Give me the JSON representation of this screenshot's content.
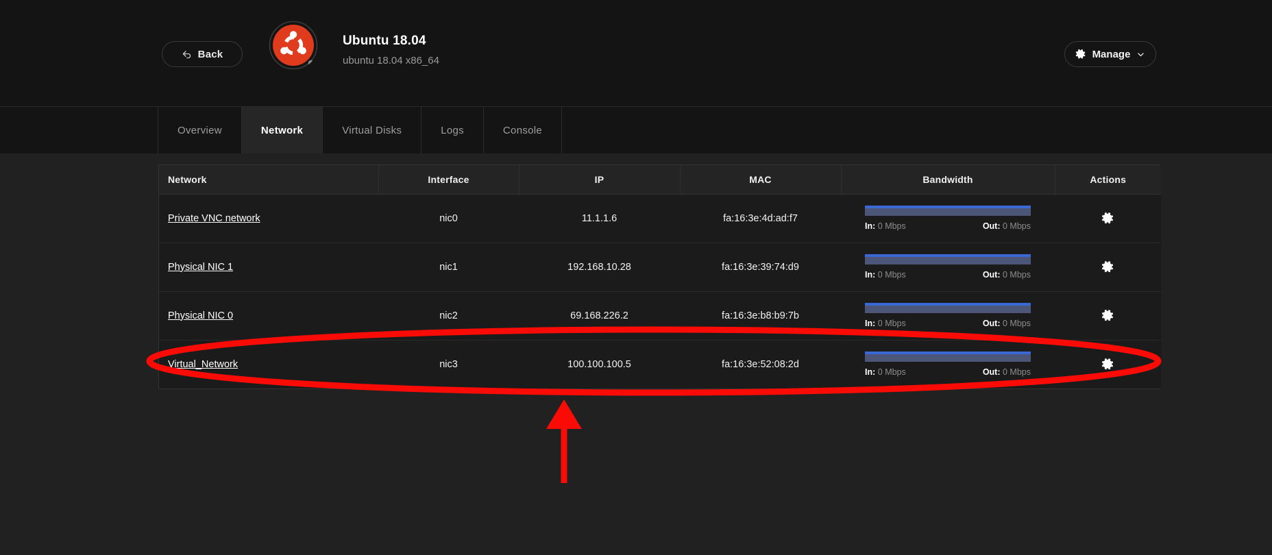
{
  "header": {
    "back_label": "Back",
    "back_icon": "back-arrow-icon",
    "os_title": "Ubuntu 18.04",
    "os_subtitle": "ubuntu 18.04 x86_64",
    "logo_icon": "ubuntu-logo-icon",
    "logo_color": "#e03b1c",
    "manage_label": "Manage",
    "manage_icon": "gear-icon",
    "manage_caret_icon": "chevron-down-icon"
  },
  "tabs": [
    {
      "label": "Overview",
      "active": false
    },
    {
      "label": "Network",
      "active": true
    },
    {
      "label": "Virtual Disks",
      "active": false
    },
    {
      "label": "Logs",
      "active": false
    },
    {
      "label": "Console",
      "active": false
    }
  ],
  "table": {
    "columns": [
      "Network",
      "Interface",
      "IP",
      "MAC",
      "Bandwidth",
      "Actions"
    ],
    "bandwidth_in_label": "In:",
    "bandwidth_out_label": "Out:",
    "action_icon": "gear-icon",
    "rows": [
      {
        "network": "Private VNC network",
        "interface": "nic0",
        "ip": "11.1.1.6",
        "mac": "fa:16:3e:4d:ad:f7",
        "bw_in": "0 Mbps",
        "bw_out": "0 Mbps"
      },
      {
        "network": "Physical NIC 1",
        "interface": "nic1",
        "ip": "192.168.10.28",
        "mac": "fa:16:3e:39:74:d9",
        "bw_in": "0 Mbps",
        "bw_out": "0 Mbps"
      },
      {
        "network": "Physical NIC 0",
        "interface": "nic2",
        "ip": "69.168.226.2",
        "mac": "fa:16:3e:b8:b9:7b",
        "bw_in": "0 Mbps",
        "bw_out": "0 Mbps"
      },
      {
        "network": "Virtual_Network",
        "interface": "nic3",
        "ip": "100.100.100.5",
        "mac": "fa:16:3e:52:08:2d",
        "bw_in": "0 Mbps",
        "bw_out": "0 Mbps"
      }
    ]
  },
  "annotation": {
    "color": "#fb0b06",
    "ellipse_highlight_icon": "red-ellipse-highlight",
    "arrow_icon": "red-up-arrow"
  },
  "colors": {
    "page_bg": "#212121",
    "header_bg": "#141414",
    "table_bg": "#1b1b1b",
    "bar_track": "#4c5679",
    "bar_fill": "#3a69d6",
    "accent": "#e03b1c"
  }
}
